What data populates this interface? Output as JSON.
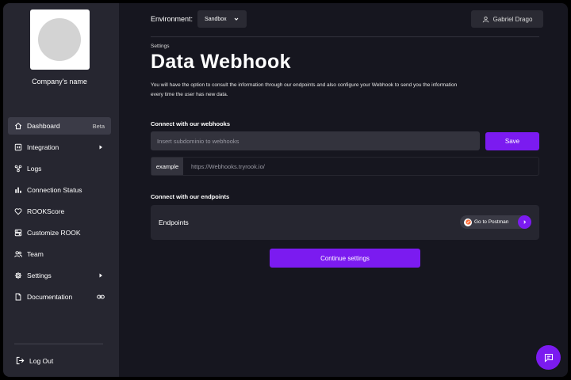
{
  "sidebar": {
    "company_name": "Company's name",
    "items": [
      {
        "label": "Dashboard",
        "badge": "Beta",
        "icon": "home-icon",
        "active": true
      },
      {
        "label": "Integration",
        "icon": "integration-icon",
        "trailing": "chevron-right-icon"
      },
      {
        "label": "Logs",
        "icon": "logs-icon"
      },
      {
        "label": "Connection Status",
        "icon": "bar-chart-icon"
      },
      {
        "label": "ROOKScore",
        "icon": "heart-icon"
      },
      {
        "label": "Customize ROOK",
        "icon": "customize-icon"
      },
      {
        "label": "Team",
        "icon": "team-icon"
      },
      {
        "label": "Settings",
        "icon": "gear-icon",
        "trailing": "chevron-right-icon"
      },
      {
        "label": "Documentation",
        "icon": "document-icon",
        "trailing": "link-icon"
      }
    ],
    "logout_label": "Log Out"
  },
  "header": {
    "environment_label": "Environment:",
    "environment_value": "Sandbox",
    "user_name": "Gabriel Drago"
  },
  "main": {
    "breadcrumb": "Settings",
    "title": "Data Webhook",
    "description": "You will have the option to consult the information through our endpoints and also configure your Webhook to send you the information every time the user has new data.",
    "webhooks": {
      "label": "Connect with our webhooks",
      "input_placeholder": "Insert subdominio to webhooks",
      "input_value": "",
      "save_label": "Save",
      "example_tag": "example",
      "example_url": "https://Webhooks.tryrook.io/"
    },
    "endpoints": {
      "label": "Connect with our endpoints",
      "card_label": "Endpoints",
      "postman_label": "Go to Postman"
    },
    "continue_label": "Continue settings"
  },
  "colors": {
    "accent": "#7b1bf0",
    "background": "#16161f",
    "sidebar": "#262630"
  }
}
